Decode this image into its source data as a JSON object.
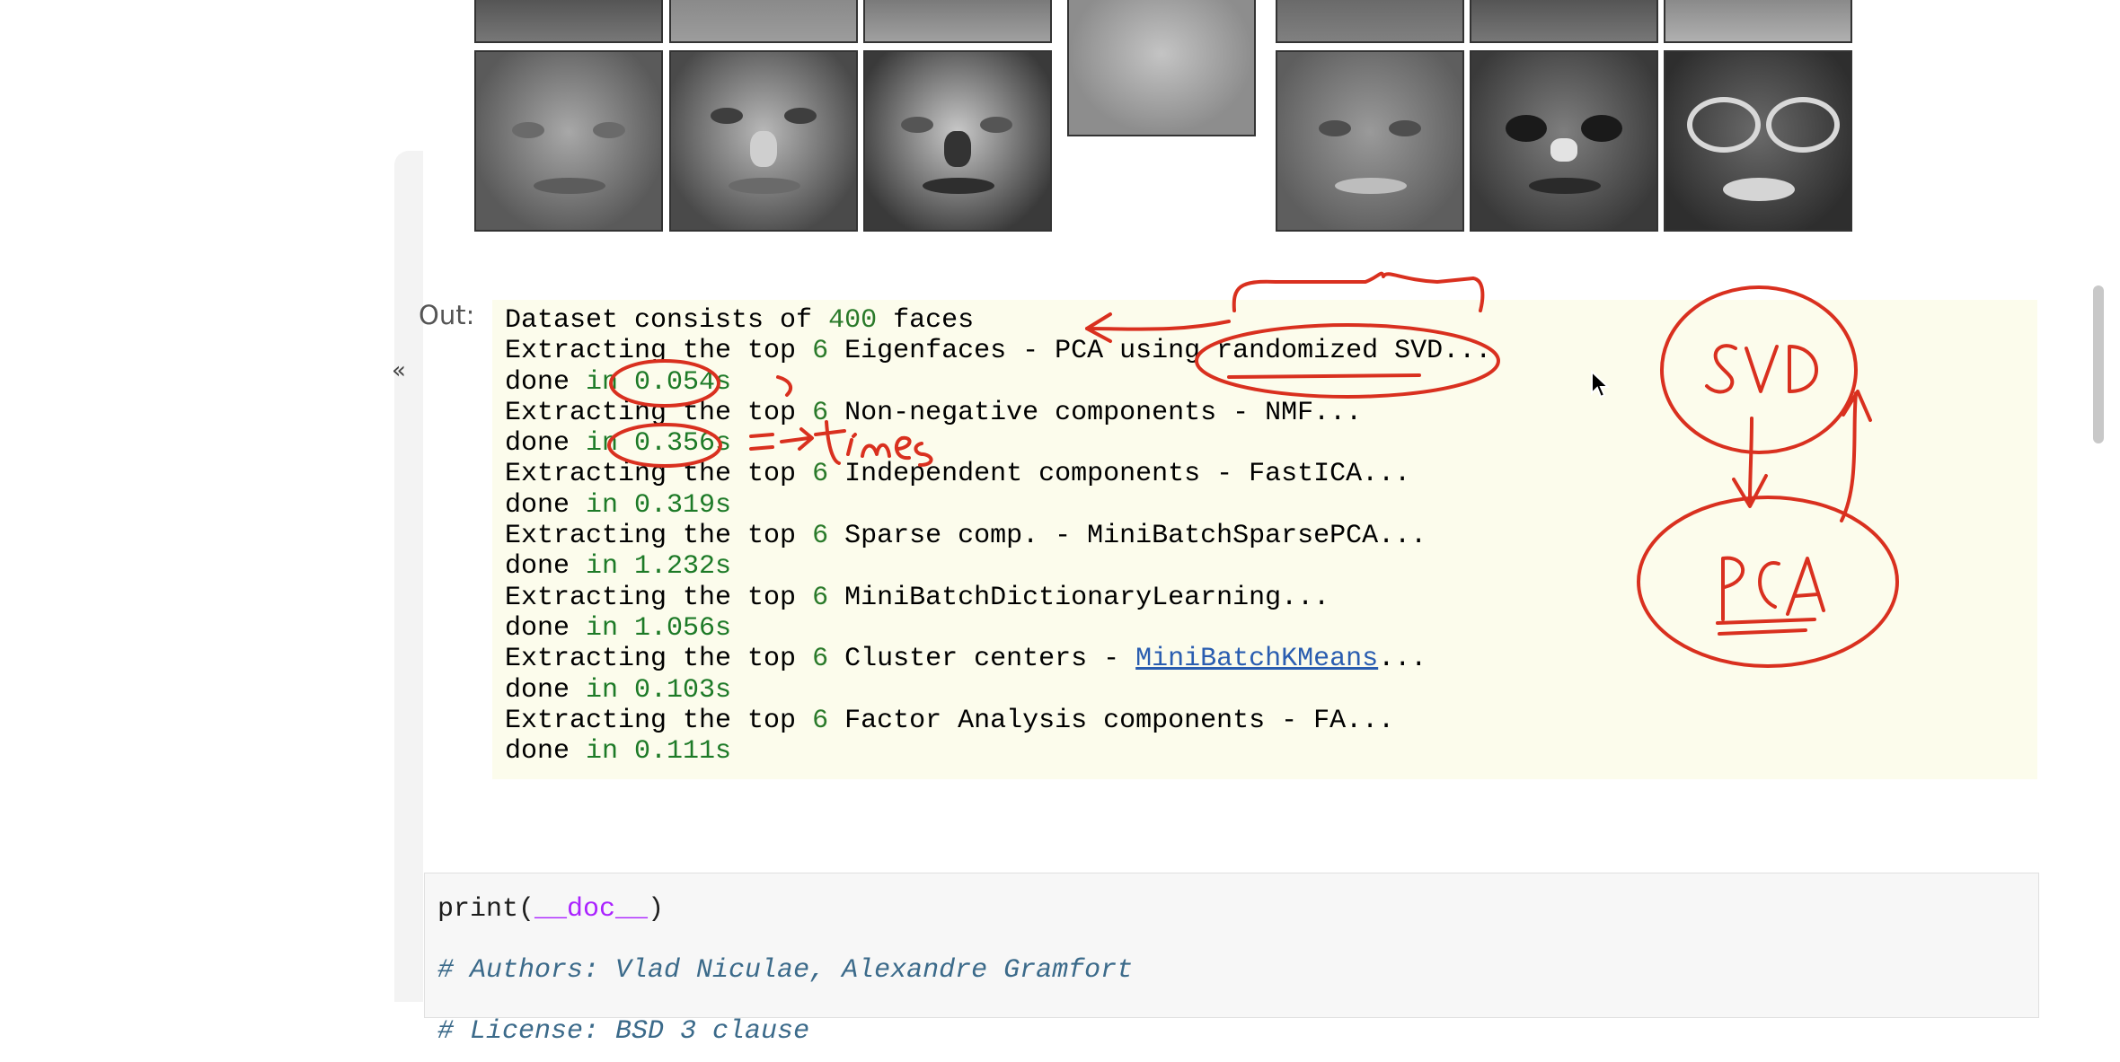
{
  "notebook": {
    "collapse_glyph": "«",
    "out_prompt": "Out:",
    "output_lines": [
      {
        "a": "Dataset consists of ",
        "n": "400",
        "b": " faces",
        "link": "",
        "c": ""
      },
      {
        "a": "Extracting the top ",
        "n": "6",
        "b": " Eigenfaces - PCA using randomized SVD...",
        "link": "",
        "c": ""
      },
      {
        "a": "done ",
        "n": "",
        "b": "in 0.054s",
        "link": "",
        "c": ""
      },
      {
        "a": "Extracting the top ",
        "n": "6",
        "b": " Non-negative components - NMF...",
        "link": "",
        "c": ""
      },
      {
        "a": "done ",
        "n": "",
        "b": "in 0.356s",
        "link": "",
        "c": ""
      },
      {
        "a": "Extracting the top ",
        "n": "6",
        "b": " Independent components - FastICA...",
        "link": "",
        "c": ""
      },
      {
        "a": "done ",
        "n": "",
        "b": "in 0.319s",
        "link": "",
        "c": ""
      },
      {
        "a": "Extracting the top ",
        "n": "6",
        "b": " Sparse comp. - MiniBatchSparsePCA...",
        "link": "",
        "c": ""
      },
      {
        "a": "done ",
        "n": "",
        "b": "in 1.232s",
        "link": "",
        "c": ""
      },
      {
        "a": "Extracting the top ",
        "n": "6",
        "b": " MiniBatchDictionaryLearning...",
        "link": "",
        "c": ""
      },
      {
        "a": "done ",
        "n": "",
        "b": "in 1.056s",
        "link": "",
        "c": ""
      },
      {
        "a": "Extracting the top ",
        "n": "6",
        "b": " Cluster centers - ",
        "link": "MiniBatchKMeans",
        "c": "..."
      },
      {
        "a": "done ",
        "n": "",
        "b": "in 0.103s",
        "link": "",
        "c": ""
      },
      {
        "a": "Extracting the top ",
        "n": "6",
        "b": " Factor Analysis components - FA...",
        "link": "",
        "c": ""
      },
      {
        "a": "done ",
        "n": "",
        "b": "in 0.111s",
        "link": "",
        "c": ""
      }
    ],
    "code": {
      "print_fn": "print(",
      "print_arg": "__doc__",
      "print_close": ")",
      "comment_1": "# Authors: Vlad Niculae, Alexandre Gramfort",
      "comment_2": "# License: BSD 3 clause"
    }
  },
  "annotations": {
    "note_times": "= 7 times",
    "svd": "SVD",
    "pca": "PCA",
    "color": "#d9301f"
  },
  "faces": {
    "tones": [
      "#8a8a8a",
      "#9a9a9a",
      "#7f7f7f",
      "#a5a5a5",
      "#6f6f6f",
      "#7b7b7b",
      "#909090"
    ]
  }
}
